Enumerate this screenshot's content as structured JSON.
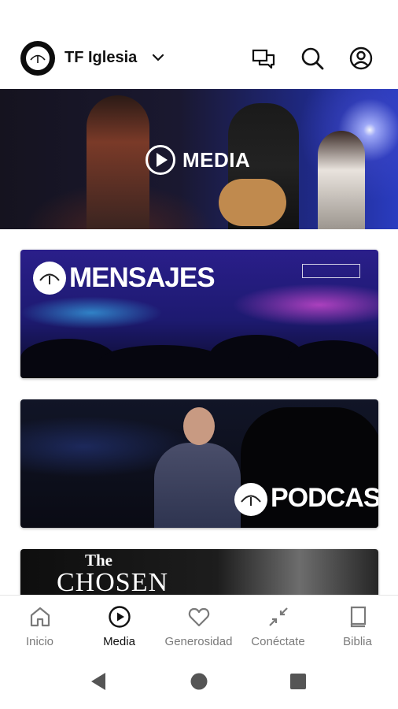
{
  "header": {
    "org_name": "TF Iglesia",
    "icons": [
      "brand-logo-icon",
      "chevron-down-icon",
      "chat-icon",
      "search-icon",
      "account-icon"
    ]
  },
  "hero": {
    "title": "MEDIA",
    "icon": "play-circle-icon"
  },
  "cards": [
    {
      "title": "MENSAJES"
    },
    {
      "title": "PODCAST"
    },
    {
      "title_line1": "The",
      "title_line2": "CHOSEN"
    }
  ],
  "bottom_nav": {
    "items": [
      {
        "label": "Inicio",
        "icon": "home-icon"
      },
      {
        "label": "Media",
        "icon": "play-circle-icon",
        "active": true
      },
      {
        "label": "Generosidad",
        "icon": "heart-icon"
      },
      {
        "label": "Conéctate",
        "icon": "compress-arrows-icon"
      },
      {
        "label": "Biblia",
        "icon": "book-icon"
      }
    ]
  },
  "system_nav": {
    "icons": [
      "back-icon",
      "home-circle-icon",
      "recents-square-icon"
    ]
  },
  "colors": {
    "accent": "#111111",
    "inactive_label": "#7a7a7a",
    "background": "#ffffff"
  }
}
